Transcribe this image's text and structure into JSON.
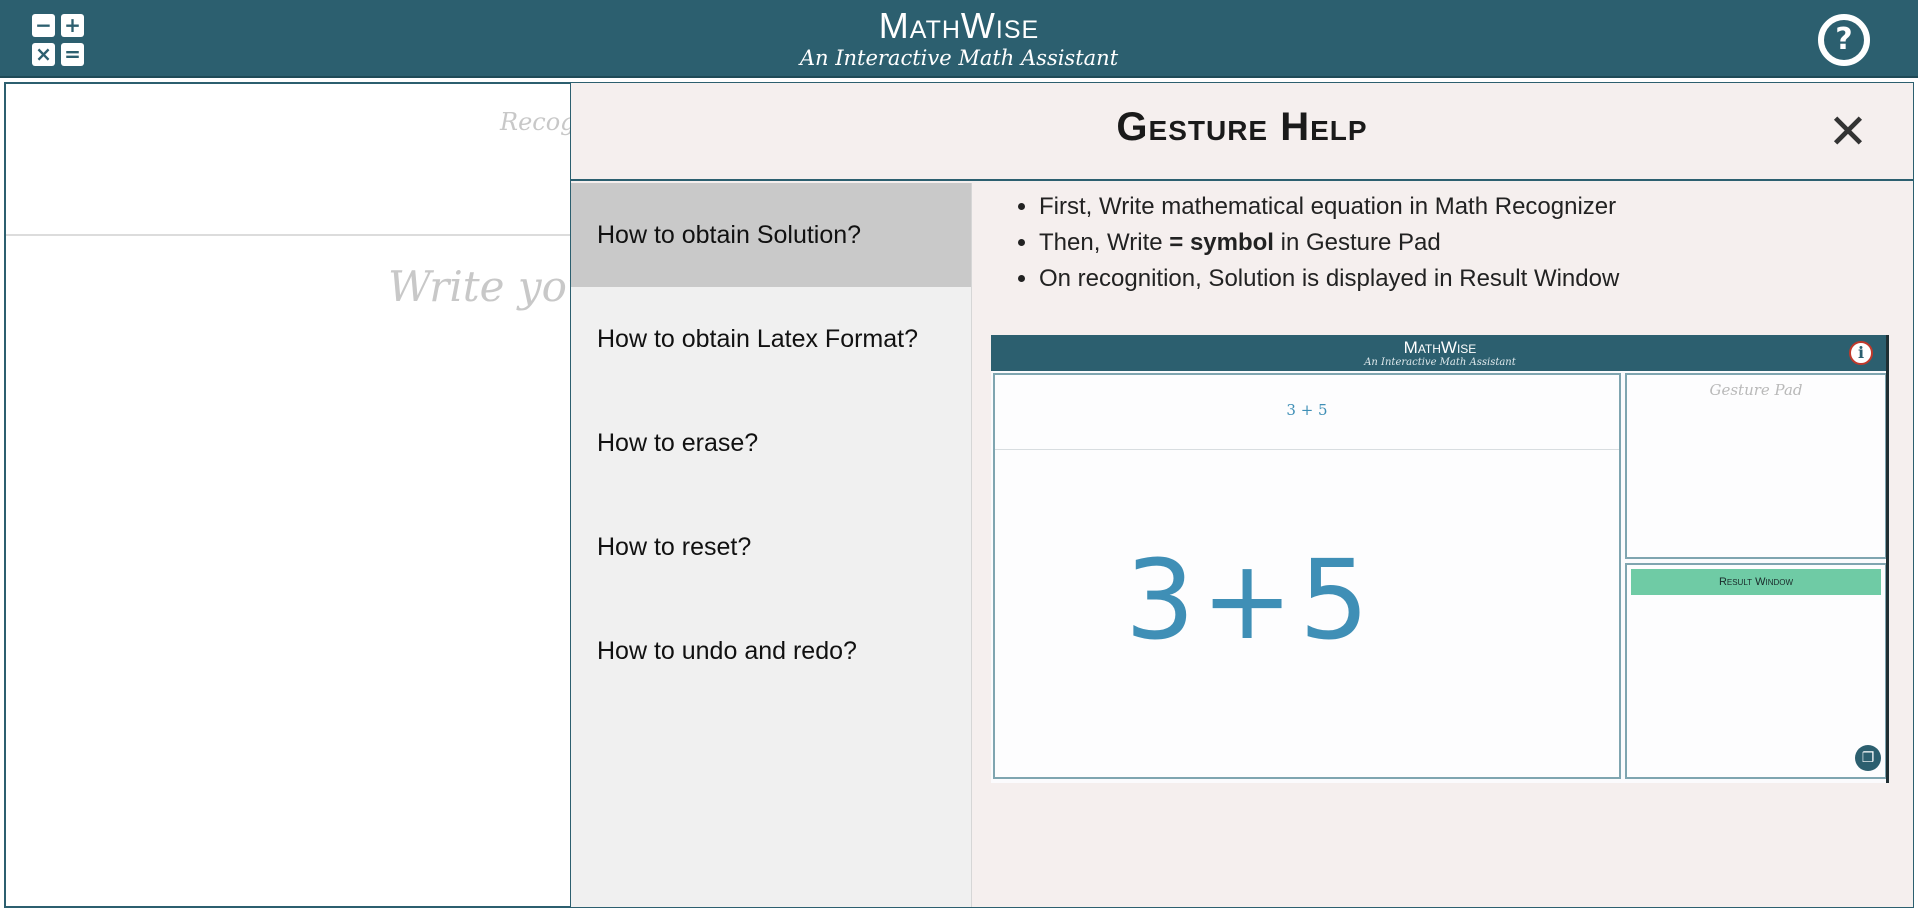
{
  "header": {
    "title": "MathWise",
    "subtitle": "An Interactive Math Assistant",
    "calc_symbols": [
      "−",
      "+",
      "×",
      "="
    ],
    "help_symbol": "?"
  },
  "workspace": {
    "recognizer_hint": "Recog",
    "write_hint": "Write you"
  },
  "modal": {
    "title": "Gesture Help",
    "close_symbol": "✕",
    "nav_items": [
      {
        "label": "How to obtain Solution?",
        "active": true
      },
      {
        "label": "How to obtain Latex Format?",
        "active": false
      },
      {
        "label": "How to erase?",
        "active": false
      },
      {
        "label": "How to reset?",
        "active": false
      },
      {
        "label": "How to undo and redo?",
        "active": false
      }
    ],
    "bullets": {
      "first": "First, Write mathematical equation in Math Recognizer",
      "second_pre": "Then, Write ",
      "second_bold": "= symbol",
      "second_post": " in Gesture Pad",
      "third": "On recognition, Solution is displayed in Result Window"
    },
    "preview": {
      "title": "MathWise",
      "subtitle": "An Interactive Math Assistant",
      "info_symbol": "i",
      "recognized": "3 + 5",
      "handwritten": "3+5",
      "gesture_label": "Gesture Pad",
      "result_label": "Result Window",
      "copy_symbol": "❐"
    }
  },
  "colors": {
    "header_bg": "#2c5f6f",
    "modal_bg": "#f5efee",
    "active_nav": "#c9c9c9",
    "result_bar": "#6fcba5",
    "ink": "#3f8fb6"
  }
}
